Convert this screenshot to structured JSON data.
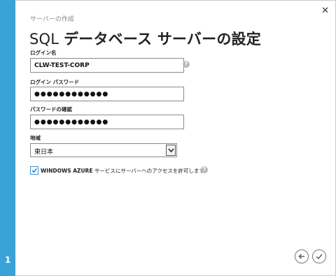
{
  "wizard": {
    "step_number": "1",
    "subtitle": "サーバーの作成",
    "title_prefix": "SQL",
    "title_main": "データベース サーバーの設定"
  },
  "fields": {
    "login_label": "ログイン名",
    "login_value": "CLW-TEST-CORP",
    "password_label": "ログイン パスワード",
    "password_value": "●●●●●●●●●●●●",
    "confirm_label": "パスワードの確認",
    "confirm_value": "●●●●●●●●●●●●",
    "region_label": "地域",
    "region_value": "東日本"
  },
  "checkbox": {
    "checked": true,
    "label_bold": "WINDOWS AZURE",
    "label_rest": " サービスにサーバーへのアクセスを許可します。"
  },
  "icons": {
    "close": "close-icon",
    "help": "help-icon",
    "back": "back-arrow-icon",
    "complete": "checkmark-icon"
  },
  "colors": {
    "accent": "#3aa2d6"
  }
}
